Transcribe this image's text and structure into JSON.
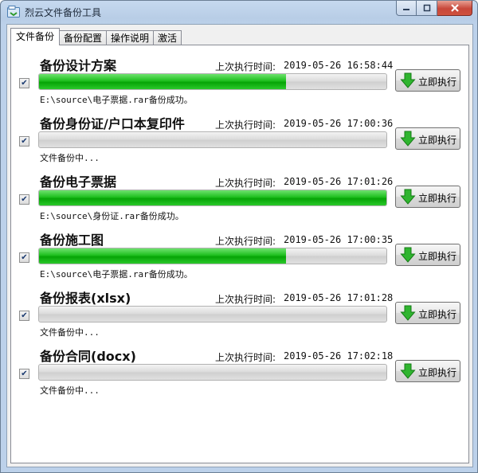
{
  "window": {
    "title": "烈云文件备份工具"
  },
  "tabs": [
    {
      "label": "文件备份",
      "active": true
    },
    {
      "label": "备份配置",
      "active": false
    },
    {
      "label": "操作说明",
      "active": false
    },
    {
      "label": "激活",
      "active": false
    }
  ],
  "labels": {
    "last_run": "上次执行时间:",
    "run_now": "立即执行"
  },
  "colors": {
    "progress_fill": "#16b816",
    "button_icon": "#2fb52f"
  },
  "jobs": [
    {
      "name": "备份设计方案",
      "last_run": "2019-05-26 16:58:44",
      "checked": true,
      "progress": 0.71,
      "status": "E:\\source\\电子票据.rar备份成功。"
    },
    {
      "name": "备份身份证/户口本复印件",
      "last_run": "2019-05-26 17:00:36",
      "checked": true,
      "progress": 0,
      "status": "文件备份中..."
    },
    {
      "name": "备份电子票据",
      "last_run": "2019-05-26 17:01:26",
      "checked": true,
      "progress": 1.0,
      "status": "E:\\source\\身份证.rar备份成功。"
    },
    {
      "name": "备份施工图",
      "last_run": "2019-05-26 17:00:35",
      "checked": true,
      "progress": 0.71,
      "status": "E:\\source\\电子票据.rar备份成功。"
    },
    {
      "name": "备份报表(xlsx)",
      "last_run": "2019-05-26 17:01:28",
      "checked": true,
      "progress": 0,
      "status": "文件备份中..."
    },
    {
      "name": "备份合同(docx)",
      "last_run": "2019-05-26 17:02:18",
      "checked": true,
      "progress": 0,
      "status": "文件备份中..."
    }
  ]
}
